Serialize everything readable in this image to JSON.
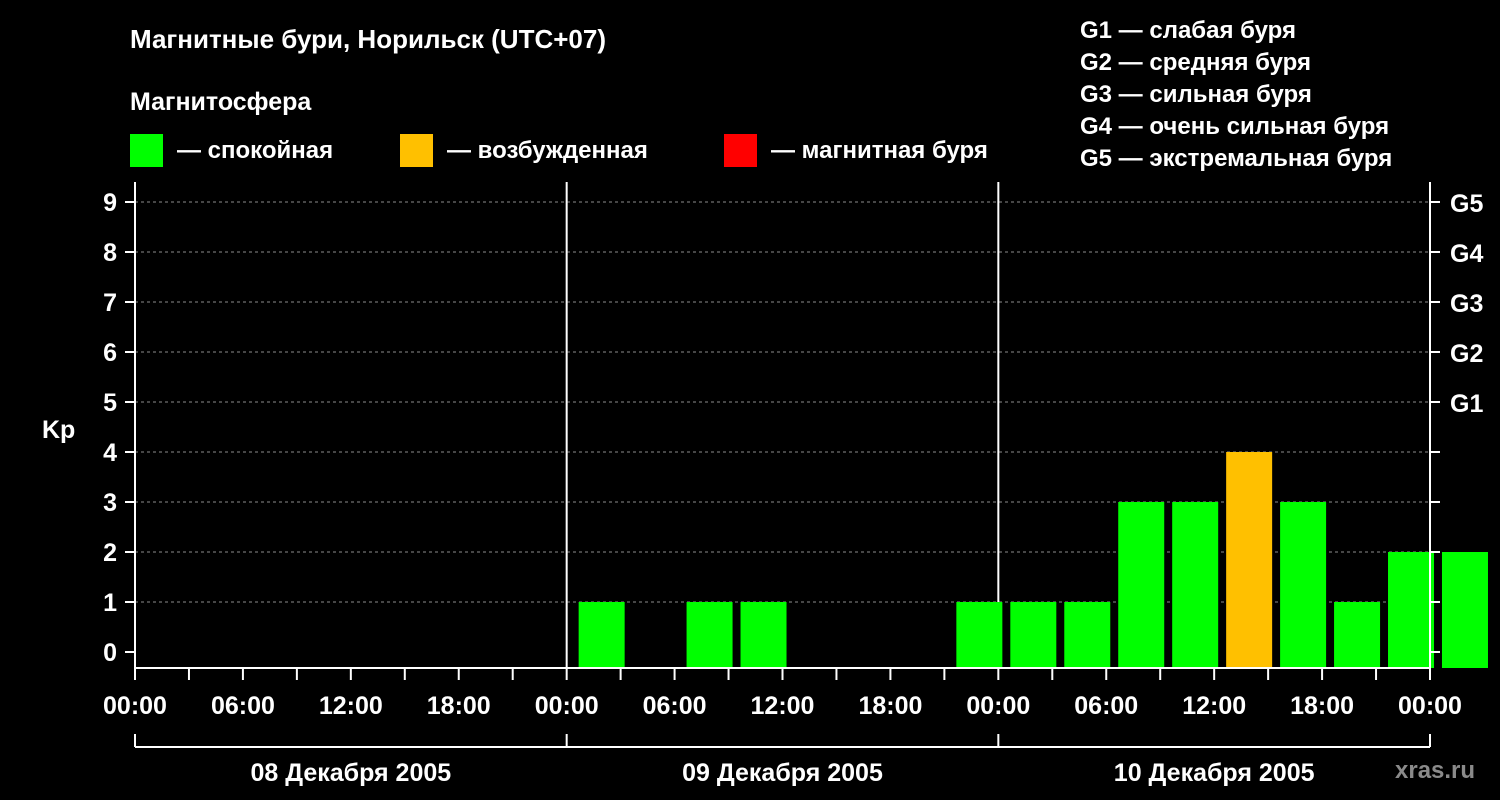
{
  "header": {
    "title": "Магнитные бури, Норильск (UTC+07)",
    "subtitle": "Магнитосфера"
  },
  "legend": [
    {
      "label": "— спокойная",
      "color": "#00ff00"
    },
    {
      "label": "— возбужденная",
      "color": "#ffc000"
    },
    {
      "label": "— магнитная буря",
      "color": "#ff0000"
    }
  ],
  "g_legend": [
    "G1 — слабая буря",
    "G2 — средняя буря",
    "G3 — сильная буря",
    "G4 — очень сильная буря",
    "G5 — экстремальная буря"
  ],
  "watermark": "xras.ru",
  "chart_data": {
    "type": "bar",
    "ylabel": "Kp",
    "ylim": [
      0,
      9
    ],
    "yticks": [
      0,
      1,
      2,
      3,
      4,
      5,
      6,
      7,
      8,
      9
    ],
    "g_levels": [
      {
        "label": "G1",
        "kp": 5
      },
      {
        "label": "G2",
        "kp": 6
      },
      {
        "label": "G3",
        "kp": 7
      },
      {
        "label": "G4",
        "kp": 8
      },
      {
        "label": "G5",
        "kp": 9
      }
    ],
    "x_tick_labels": [
      "00:00",
      "06:00",
      "12:00",
      "18:00",
      "00:00",
      "06:00",
      "12:00",
      "18:00",
      "00:00",
      "06:00",
      "12:00",
      "18:00",
      "00:00"
    ],
    "days": [
      "08 Декабря 2005",
      "09 Декабря 2005",
      "10 Декабря 2005"
    ],
    "interval_hours": 3,
    "grid": "horizontal dashed",
    "values": [
      0,
      0,
      0,
      0,
      0,
      0,
      0,
      0,
      1,
      0,
      1,
      1,
      0,
      0,
      0,
      1,
      1,
      1,
      3,
      3,
      4,
      3,
      1,
      2,
      2
    ],
    "colors": {
      "quiet": "#00ff00",
      "active": "#ffc000",
      "storm": "#ff0000"
    }
  }
}
